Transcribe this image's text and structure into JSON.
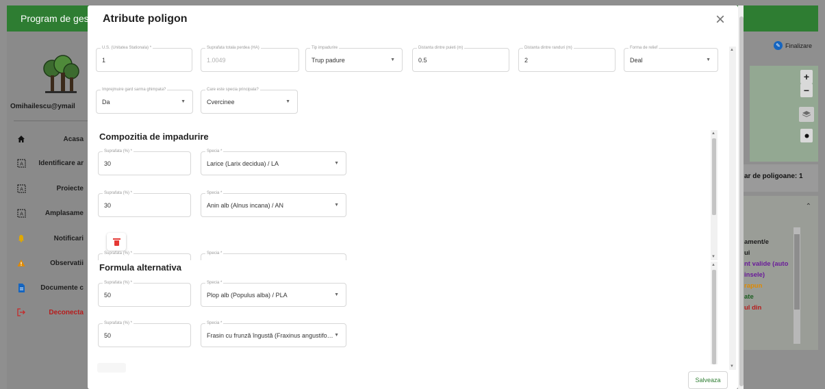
{
  "app": {
    "title": "Program de gest",
    "user_email": "Omihailescu@ymail",
    "sidebar": [
      {
        "label": "Acasa",
        "icon": "home-icon"
      },
      {
        "label": "Identificare ar",
        "icon": "map-frame-icon"
      },
      {
        "label": "Proiecte",
        "icon": "map-frame-icon"
      },
      {
        "label": "Amplasame",
        "icon": "map-frame-icon"
      },
      {
        "label": "Notificari",
        "icon": "bell-icon"
      },
      {
        "label": "Observatii",
        "icon": "warning-icon"
      },
      {
        "label": "Documente c",
        "icon": "document-icon"
      },
      {
        "label": "Deconecta",
        "icon": "logout-icon"
      }
    ],
    "finalize_label": "Finalizare",
    "poly_count_label": "ar de poligoane: 1",
    "legend_items": [
      {
        "text": "ament/e",
        "color": "#1a1a1a"
      },
      {
        "text": "ui",
        "color": "#1a1a1a"
      },
      {
        "text": "nt valide (auto",
        "color": "#6a1b9a"
      },
      {
        "text": "insele)",
        "color": "#6a1b9a"
      },
      {
        "text": "rapun",
        "color": "#e08a00"
      },
      {
        "text": "ate",
        "color": "#1b5e20"
      },
      {
        "text": "ul din",
        "color": "#b71c1c"
      }
    ],
    "colors": {
      "header": "#2e7d32",
      "accent": "#2e7d32",
      "danger": "#e53935"
    }
  },
  "modal": {
    "title": "Atribute poligon",
    "fields": {
      "us": {
        "label": "U.S. (Unitatea Stationala) *",
        "value": "1"
      },
      "suprafata": {
        "label": "Suprafata totala perdea (HA)",
        "value": "1.0049"
      },
      "tip": {
        "label": "Tip impadurire",
        "value": "Trup padure"
      },
      "dist_puieti": {
        "label": "Distanta dintre puieti (m)",
        "value": "0.5"
      },
      "dist_randuri": {
        "label": "Distanta dintre randuri (m)",
        "value": "2"
      },
      "relief": {
        "label": "Forma de relief",
        "value": "Deal"
      },
      "gard": {
        "label": "Imprejmuire gard sarma ghimpata?",
        "value": "Da"
      },
      "specia_princ": {
        "label": "Care este specia principala?",
        "value": "Cvercinee"
      }
    },
    "compozitie": {
      "title": "Compozitia de impadurire",
      "rows": [
        {
          "pct_label": "Suprafata (%) *",
          "pct": "30",
          "specie_label": "Specia *",
          "specie": "Larice (Larix decidua) / LA"
        },
        {
          "pct_label": "Suprafata (%) *",
          "pct": "30",
          "specie_label": "Specia *",
          "specie": "Anin alb (Alnus incana) / AN"
        }
      ],
      "partial_pct_label": "Suprafata (%) *",
      "partial_specie_label": "Specia *"
    },
    "formula": {
      "title": "Formula alternativa",
      "rows": [
        {
          "pct_label": "Suprafata (%) *",
          "pct": "50",
          "specie_label": "Specia *",
          "specie": "Plop alb (Populus alba) / PLA"
        },
        {
          "pct_label": "Suprafata (%) *",
          "pct": "50",
          "specie_label": "Specia *",
          "specie": "Frasin cu frunză îngustă (Fraxinus angustifol..."
        }
      ]
    },
    "save_label": "Salveaza"
  }
}
